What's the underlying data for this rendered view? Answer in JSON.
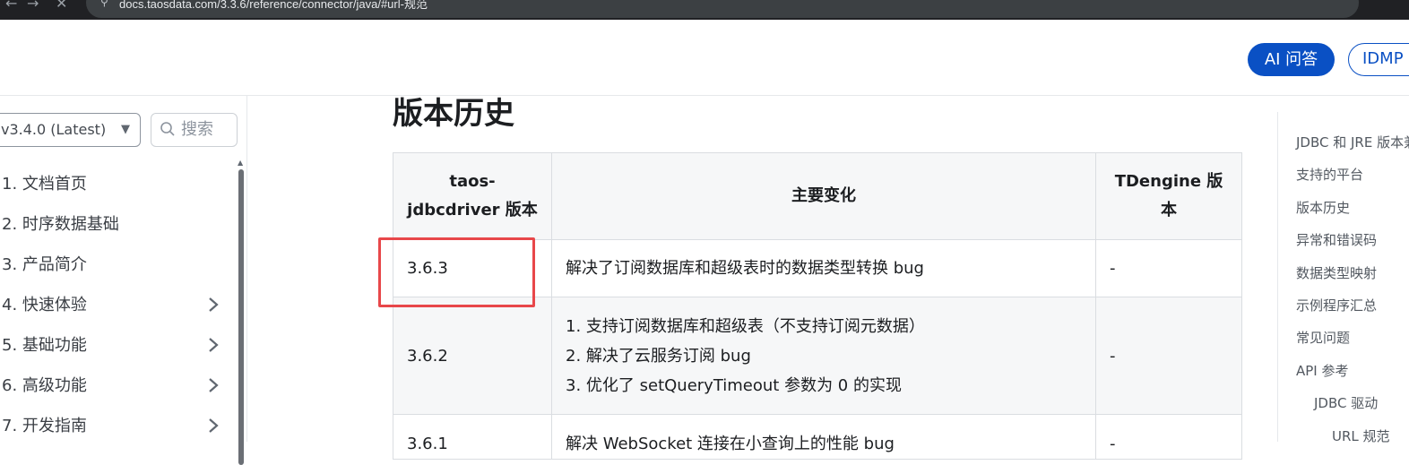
{
  "browser": {
    "url": "docs.taosdata.com/3.3.6/reference/connector/java/#url-规范",
    "back_icon": "←",
    "forward_icon": "→",
    "stop_icon": "✕"
  },
  "header": {
    "ai_button": "AI 问答",
    "idmp_button": "IDMP"
  },
  "sidebar": {
    "version": "v3.4.0 (Latest)",
    "search_placeholder": "搜索",
    "items": [
      {
        "label": "1. 文档首页"
      },
      {
        "label": "2. 时序数据基础"
      },
      {
        "label": "3. 产品简介"
      },
      {
        "label": "4. 快速体验"
      },
      {
        "label": "5. 基础功能"
      },
      {
        "label": "6. 高级功能"
      },
      {
        "label": "7. 开发指南"
      }
    ]
  },
  "main": {
    "heading": "版本历史",
    "table": {
      "headers": [
        "taos-jdbcdriver 版本",
        "主要变化",
        "TDengine 版本"
      ],
      "rows": [
        {
          "version": "3.6.3",
          "changes": [
            "解决了订阅数据库和超级表时的数据类型转换 bug"
          ],
          "tdengine": "-"
        },
        {
          "version": "3.6.2",
          "changes": [
            "1. 支持订阅数据库和超级表（不支持订阅元数据）",
            "2. 解决了云服务订阅 bug",
            "3. 优化了 setQueryTimeout 参数为 0 的实现"
          ],
          "tdengine": "-"
        },
        {
          "version": "3.6.1",
          "changes": [
            "解决 WebSocket 连接在小查询上的性能 bug"
          ],
          "tdengine": "-"
        }
      ]
    }
  },
  "toc": {
    "items": [
      {
        "label": "JDBC 和 JRE 版本兼容性",
        "level": 0
      },
      {
        "label": "支持的平台",
        "level": 0
      },
      {
        "label": "版本历史",
        "level": 0
      },
      {
        "label": "异常和错误码",
        "level": 0
      },
      {
        "label": "数据类型映射",
        "level": 0
      },
      {
        "label": "示例程序汇总",
        "level": 0
      },
      {
        "label": "常见问题",
        "level": 0
      },
      {
        "label": "API 参考",
        "level": 0
      },
      {
        "label": "JDBC 驱动",
        "level": 1
      },
      {
        "label": "URL 规范",
        "level": 2
      }
    ]
  },
  "colors": {
    "brand": "#0a50c4",
    "highlight": "#e8474a"
  }
}
